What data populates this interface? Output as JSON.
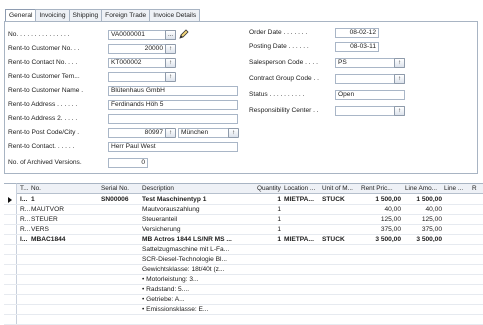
{
  "tabs": [
    "General",
    "Invoicing",
    "Shipping",
    "Foreign Trade",
    "Invoice Details"
  ],
  "left_fields": [
    {
      "label": "No. . . . . . . . . . . . . . .",
      "value": "VA0000001"
    },
    {
      "label": "Rent-to Customer No. . .",
      "value": "20000"
    },
    {
      "label": "Rent-to Contact No. . . .",
      "value": "KT000002"
    },
    {
      "label": "Rent-to Customer Tem...",
      "value": ""
    },
    {
      "label": "Rent-to Customer Name .",
      "value": "Blütenhaus GmbH"
    },
    {
      "label": "Rent-to Address . . . . . .",
      "value": "Ferdinands Höh 5"
    },
    {
      "label": "Rent-to Address 2. . . . .",
      "value": ""
    },
    {
      "label": "Rent-to Post Code/City .",
      "value": "80997",
      "value2": "München"
    },
    {
      "label": "Rent-to Contact. . . . . .",
      "value": "Herr Paul West"
    },
    {
      "label": "No. of Archived Versions.",
      "value": "0"
    }
  ],
  "right_fields": [
    {
      "label": "Order Date . . . . . . .",
      "value": "08-02-12"
    },
    {
      "label": "Posting Date . . . . . .",
      "value": "08-03-11"
    },
    {
      "label": "Salesperson Code . . . .",
      "value": "PS"
    },
    {
      "label": "Contract Group Code . .",
      "value": ""
    },
    {
      "label": "Status . . . . . . . . . .",
      "value": "Open"
    },
    {
      "label": "Responsibility Center . .",
      "value": ""
    }
  ],
  "buttons": {
    "ellipsis": "...",
    "lookup": "↑"
  },
  "grid": {
    "headers": [
      "T...",
      "No.",
      "Serial No.",
      "Description",
      "Quantity",
      "Location ...",
      "Unit of M...",
      "Rent Pric...",
      "Line Amo...",
      "Line ...",
      "R"
    ],
    "rows": [
      {
        "t": "I...",
        "no": "1",
        "serial": "SN00006",
        "desc": "Test Maschinentyp 1",
        "qty": "1",
        "loc": "MIETPA...",
        "unit": "STÜCK",
        "price": "1 500,00",
        "amount": "1 500,00",
        "bold": true,
        "selected": true
      },
      {
        "t": "R...",
        "no": "MAUTVOR",
        "serial": "",
        "desc": "Mautvorauszahlung",
        "qty": "1",
        "loc": "",
        "unit": "",
        "price": "40,00",
        "amount": "40,00",
        "bold": false
      },
      {
        "t": "R...",
        "no": "STEUER",
        "serial": "",
        "desc": "Steueranteil",
        "qty": "1",
        "loc": "",
        "unit": "",
        "price": "125,00",
        "amount": "125,00",
        "bold": false
      },
      {
        "t": "R...",
        "no": "VERS",
        "serial": "",
        "desc": "Versicherung",
        "qty": "1",
        "loc": "",
        "unit": "",
        "price": "375,00",
        "amount": "375,00",
        "bold": false
      },
      {
        "t": "I...",
        "no": "MBAC1844",
        "serial": "",
        "desc": "MB Actros 1844 LS/NR MS ...",
        "qty": "1",
        "loc": "MIETPA...",
        "unit": "STÜCK",
        "price": "3 500,00",
        "amount": "3 500,00",
        "bold": true
      },
      {
        "t": "",
        "no": "",
        "serial": "",
        "desc": "Sattelzugmaschine mit L-Fa...",
        "qty": "",
        "loc": "",
        "unit": "",
        "price": "",
        "amount": "",
        "bold": false
      },
      {
        "t": "",
        "no": "",
        "serial": "",
        "desc": "SCR-Diesel-Technologie  Bl...",
        "qty": "",
        "loc": "",
        "unit": "",
        "price": "",
        "amount": "",
        "bold": false
      },
      {
        "t": "",
        "no": "",
        "serial": "",
        "desc": "Gewichtsklasse: 18t/40t (z...",
        "qty": "",
        "loc": "",
        "unit": "",
        "price": "",
        "amount": "",
        "bold": false
      },
      {
        "t": "",
        "no": "",
        "serial": "",
        "desc": "• Motorleistung:          3...",
        "qty": "",
        "loc": "",
        "unit": "",
        "price": "",
        "amount": "",
        "bold": false
      },
      {
        "t": "",
        "no": "",
        "serial": "",
        "desc": "• Radstand:                  5....",
        "qty": "",
        "loc": "",
        "unit": "",
        "price": "",
        "amount": "",
        "bold": false
      },
      {
        "t": "",
        "no": "",
        "serial": "",
        "desc": "• Getriebe:                  A...",
        "qty": "",
        "loc": "",
        "unit": "",
        "price": "",
        "amount": "",
        "bold": false
      },
      {
        "t": "",
        "no": "",
        "serial": "",
        "desc": "• Emissionsklasse:       E...",
        "qty": "",
        "loc": "",
        "unit": "",
        "price": "",
        "amount": "",
        "bold": false
      },
      {
        "t": "",
        "no": "",
        "serial": "",
        "desc": "",
        "qty": "",
        "loc": "",
        "unit": "",
        "price": "",
        "amount": "",
        "bold": false
      }
    ]
  }
}
